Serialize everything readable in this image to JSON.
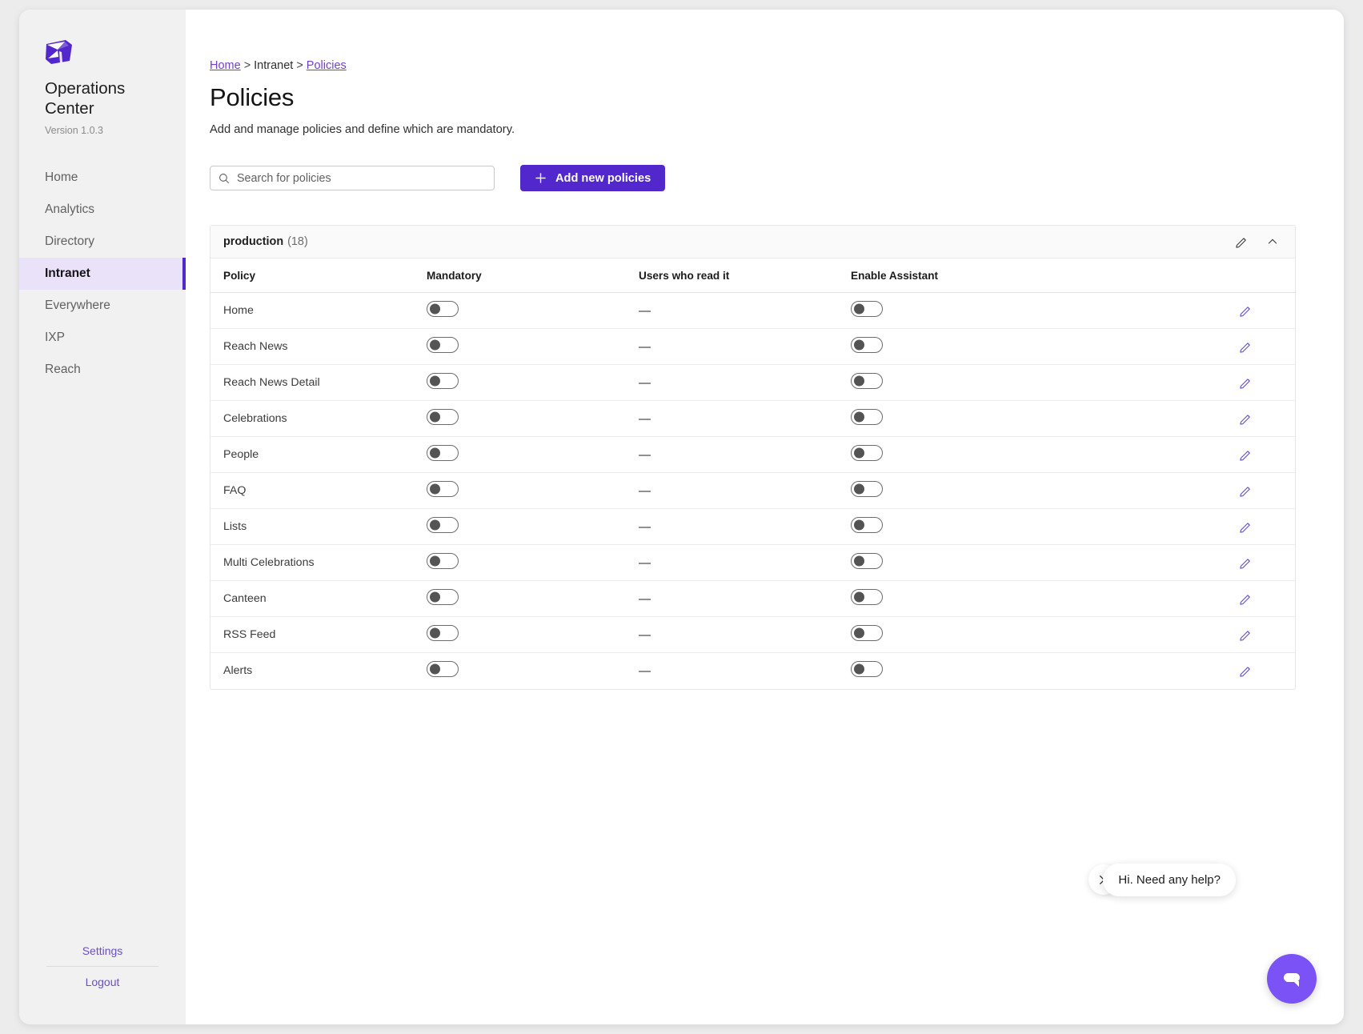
{
  "brand": {
    "logo_icon": "cube-logo-icon",
    "name": "Operations Center",
    "version": "Version 1.0.3"
  },
  "sidebar": {
    "items": [
      {
        "label": "Home",
        "active": false
      },
      {
        "label": "Analytics",
        "active": false
      },
      {
        "label": "Directory",
        "active": false
      },
      {
        "label": "Intranet",
        "active": true
      },
      {
        "label": "Everywhere",
        "active": false
      },
      {
        "label": "IXP",
        "active": false
      },
      {
        "label": "Reach",
        "active": false
      }
    ],
    "footer": {
      "settings_label": "Settings",
      "logout_label": "Logout"
    }
  },
  "breadcrumb": {
    "home": "Home",
    "sep": ">",
    "intranet": "Intranet",
    "policies": "Policies"
  },
  "header": {
    "title": "Policies",
    "subtitle": "Add and manage policies and define which are mandatory."
  },
  "toolbar": {
    "search_placeholder": "Search for policies",
    "search_value": "",
    "search_icon": "search-icon",
    "add_button_label": "Add new policies",
    "add_button_icon": "plus-icon"
  },
  "group": {
    "name": "production",
    "count": "(18)",
    "edit_icon": "pencil-icon",
    "collapse_icon": "chevron-up-icon"
  },
  "table": {
    "columns": [
      "Policy",
      "Mandatory",
      "Users who read it",
      "Enable Assistant"
    ],
    "row_edit_icon": "pencil-icon",
    "rows": [
      {
        "policy": "Home",
        "mandatory": false,
        "users_who_read_it": "—",
        "enable_assistant": false
      },
      {
        "policy": "Reach News",
        "mandatory": false,
        "users_who_read_it": "—",
        "enable_assistant": false
      },
      {
        "policy": "Reach News Detail",
        "mandatory": false,
        "users_who_read_it": "—",
        "enable_assistant": false
      },
      {
        "policy": "Celebrations",
        "mandatory": false,
        "users_who_read_it": "—",
        "enable_assistant": false
      },
      {
        "policy": "People",
        "mandatory": false,
        "users_who_read_it": "—",
        "enable_assistant": false
      },
      {
        "policy": "FAQ",
        "mandatory": false,
        "users_who_read_it": "—",
        "enable_assistant": false
      },
      {
        "policy": "Lists",
        "mandatory": false,
        "users_who_read_it": "—",
        "enable_assistant": false
      },
      {
        "policy": "Multi Celebrations",
        "mandatory": false,
        "users_who_read_it": "—",
        "enable_assistant": false
      },
      {
        "policy": "Canteen",
        "mandatory": false,
        "users_who_read_it": "—",
        "enable_assistant": false
      },
      {
        "policy": "RSS Feed",
        "mandatory": false,
        "users_who_read_it": "—",
        "enable_assistant": false
      },
      {
        "policy": "Alerts",
        "mandatory": false,
        "users_who_read_it": "—",
        "enable_assistant": false
      }
    ]
  },
  "chat": {
    "message": "Hi. Need any help?",
    "close_icon": "close-icon",
    "fab_icon": "chat-bubble-icon"
  },
  "colors": {
    "accent_purple": "#5227cc",
    "link_purple": "#6b4fc4",
    "chat_purple": "#7b52f5",
    "sidebar_bg": "#f1f1f1",
    "active_nav_bg": "#eae2f8",
    "page_bg": "#ececed"
  }
}
